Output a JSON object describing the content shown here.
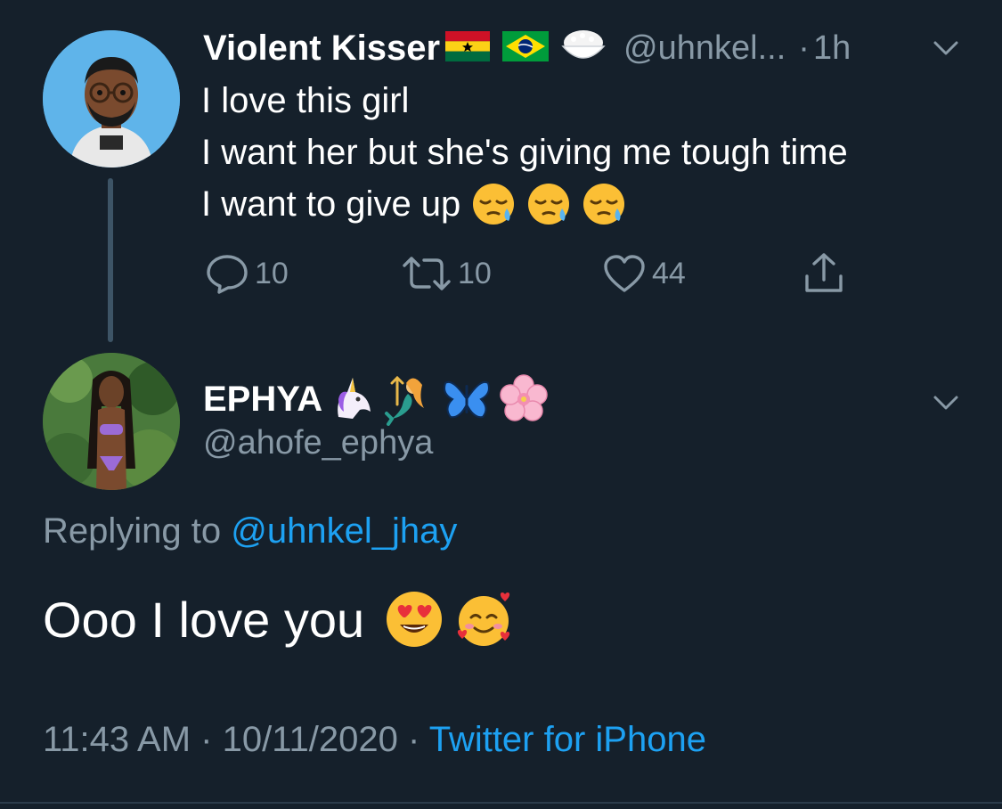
{
  "parent_tweet": {
    "display_name": "Violent Kisser",
    "name_emojis": [
      "ghana-flag",
      "brazil-flag",
      "rice-bowl"
    ],
    "handle": "@uhnkel...",
    "separator": "·",
    "time": "1h",
    "lines": [
      "I love this girl",
      "I want her but she's giving me tough time",
      "I want to give up"
    ],
    "line_emojis": [
      "sleepy-face",
      "sleepy-face",
      "sleepy-face"
    ],
    "actions": {
      "reply_count": "10",
      "retweet_count": "10",
      "like_count": "44"
    }
  },
  "reply_tweet": {
    "display_name": "EPHYA",
    "name_emojis": [
      "unicorn",
      "mermaid",
      "butterfly",
      "cherry-blossom"
    ],
    "handle": "@ahofe_ephya",
    "replying_label": "Replying to",
    "replying_to": "@uhnkel_jhay",
    "text": "Ooo I love you",
    "text_emojis": [
      "heart-eyes",
      "smiling-face-with-hearts"
    ],
    "time": "11:43 AM",
    "separator": "·",
    "date": "10/11/2020",
    "source": "Twitter for iPhone"
  },
  "colors": {
    "background": "#15202b",
    "secondary_text": "#8899a6",
    "link": "#1da1f2",
    "thread_line": "#3d5466"
  }
}
